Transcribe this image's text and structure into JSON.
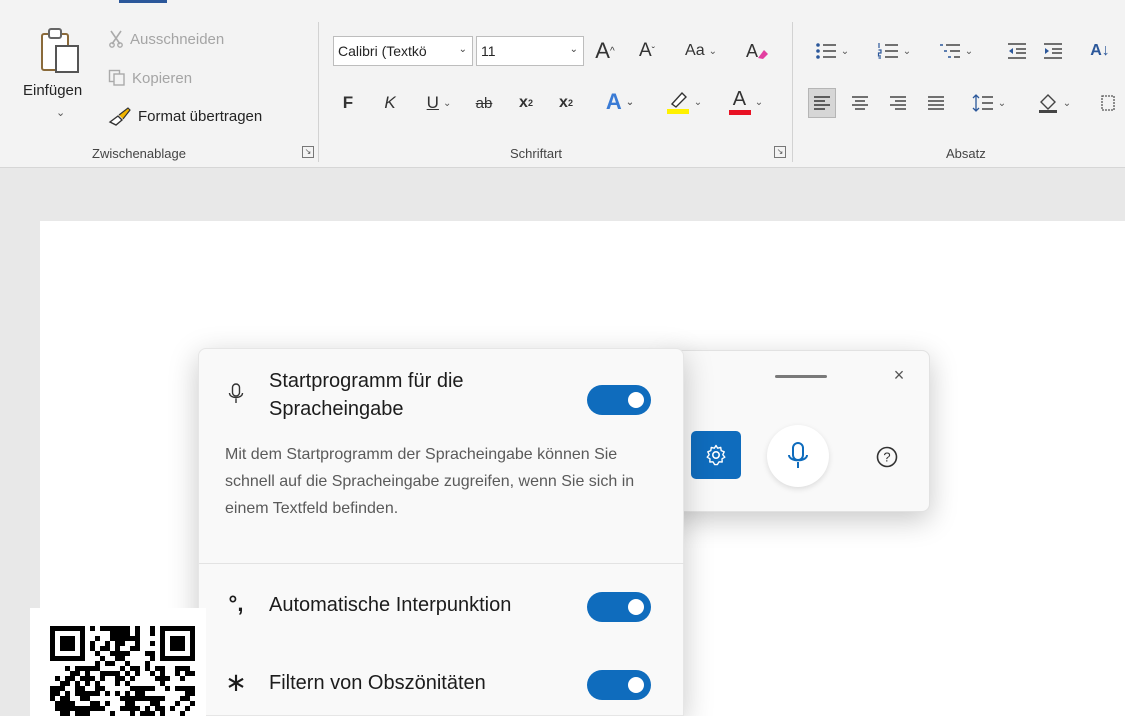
{
  "ribbon": {
    "clipboard": {
      "paste_label": "Einfügen",
      "paste_chevron": "⌄",
      "cut_label": "Ausschneiden",
      "copy_label": "Kopieren",
      "format_painter_label": "Format übertragen",
      "group_label": "Zwischenablage"
    },
    "font": {
      "font_name": "Calibri (Textkö",
      "font_size": "11",
      "grow_font": "A",
      "shrink_font": "A",
      "change_case": "Aa",
      "bold": "F",
      "italic": "K",
      "underline": "U",
      "strikethrough": "ab",
      "subscript": "x",
      "subscript_mark": "2",
      "superscript": "x",
      "superscript_mark": "2",
      "text_effects": "A",
      "font_color": "A",
      "group_label": "Schriftart"
    },
    "paragraph": {
      "sort": "A↓",
      "group_label": "Absatz"
    },
    "launcher_glyph": "↘"
  },
  "voice_toolbar": {
    "close_glyph": "×",
    "help_glyph": "?"
  },
  "flyout": {
    "launcher_title_line1": "Startprogramm für die",
    "launcher_title_line2": "Spracheingabe",
    "launcher_description": "Mit dem Startprogramm der Spracheingabe können Sie schnell auf die Spracheingabe zugreifen, wenn Sie sich in einem Textfeld befinden.",
    "launcher_enabled": true,
    "punctuation_icon": "°,",
    "punctuation_label": "Automatische Interpunktion",
    "punctuation_enabled": true,
    "profanity_icon": "∗",
    "profanity_label": "Filtern von Obszönitäten",
    "profanity_enabled": true
  },
  "colors": {
    "accent": "#0f6cbd",
    "word_blue": "#2b579a",
    "highlight_yellow": "#fff100",
    "font_red": "#e81123"
  }
}
